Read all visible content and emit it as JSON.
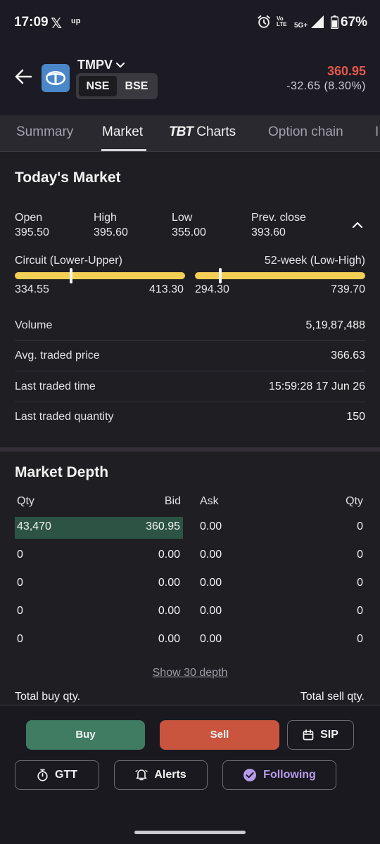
{
  "status_bar": {
    "time": "17:09",
    "x_label": "𝕏",
    "up_label": "up",
    "volte_line1": "Vo",
    "volte_line2": "LTE",
    "network": "5G+",
    "battery": "67%"
  },
  "header": {
    "symbol": "TMPV",
    "exchanges": [
      "NSE",
      "BSE"
    ],
    "selected_exchange": "NSE",
    "price": "360.95",
    "change": "-32.65 (8.30%)",
    "price_color": "#e2574c"
  },
  "tabs": [
    {
      "label": "Summary"
    },
    {
      "label": "Market",
      "active": true
    },
    {
      "label_prefix": "TBT",
      "label": "Charts"
    },
    {
      "label": "Option chain"
    },
    {
      "label": "I"
    }
  ],
  "todays_market": {
    "title": "Today's Market",
    "ohlc": [
      {
        "label": "Open",
        "value": "395.50"
      },
      {
        "label": "High",
        "value": "395.60"
      },
      {
        "label": "Low",
        "value": "355.00"
      },
      {
        "label": "Prev. close",
        "value": "393.60"
      }
    ],
    "circuit": {
      "label": "Circuit (Lower-Upper)",
      "low": "334.55",
      "high": "413.30",
      "position": 0.33
    },
    "week52": {
      "label": "52-week (Low-High)",
      "low": "294.30",
      "high": "739.70",
      "position": 0.15
    },
    "stats": [
      {
        "label": "Volume",
        "value": "5,19,87,488"
      },
      {
        "label": "Avg. traded price",
        "value": "366.63"
      },
      {
        "label": "Last traded time",
        "value": "15:59:28 17 Jun 26"
      },
      {
        "label": "Last traded quantity",
        "value": "150"
      }
    ]
  },
  "market_depth": {
    "title": "Market Depth",
    "headers": {
      "bid_qty": "Qty",
      "bid": "Bid",
      "ask": "Ask",
      "ask_qty": "Qty"
    },
    "rows": [
      {
        "bid_qty": "43,470",
        "bid": "360.95",
        "ask": "0.00",
        "ask_qty": "0"
      },
      {
        "bid_qty": "0",
        "bid": "0.00",
        "ask": "0.00",
        "ask_qty": "0"
      },
      {
        "bid_qty": "0",
        "bid": "0.00",
        "ask": "0.00",
        "ask_qty": "0"
      },
      {
        "bid_qty": "0",
        "bid": "0.00",
        "ask": "0.00",
        "ask_qty": "0"
      },
      {
        "bid_qty": "0",
        "bid": "0.00",
        "ask": "0.00",
        "ask_qty": "0"
      }
    ],
    "show_depth": "Show 30 depth",
    "total_buy": "Total buy qty.",
    "total_sell": "Total sell qty."
  },
  "actions": {
    "buy": "Buy",
    "sell": "Sell",
    "sip": "SIP",
    "gtt": "GTT",
    "alerts": "Alerts",
    "following": "Following",
    "buy_color": "#3f7c62",
    "sell_color": "#c9553f",
    "following_color": "#b79ce9"
  }
}
